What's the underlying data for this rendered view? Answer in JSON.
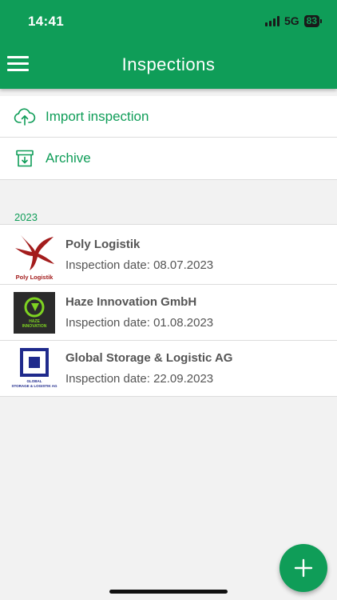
{
  "status_bar": {
    "time": "14:41",
    "network": "5G",
    "battery": "83"
  },
  "header": {
    "title": "Inspections"
  },
  "actions": [
    {
      "label": "Import inspection",
      "icon": "cloud-upload-icon"
    },
    {
      "label": "Archive",
      "icon": "archive-icon"
    }
  ],
  "section": {
    "year": "2023"
  },
  "inspections": [
    {
      "company": "Poly Logistik",
      "date": "Inspection date: 08.07.2023",
      "logo_text": "Poly Logistik",
      "logo_color": "#a31c1c"
    },
    {
      "company": "Haze Innovation GmbH",
      "date": "Inspection date: 01.08.2023",
      "logo_text_1": "HAZE",
      "logo_text_2": "INNOVATION",
      "logo_color": "#7ed321"
    },
    {
      "company": "Global Storage & Logistic AG",
      "date": "Inspection date: 22.09.2023",
      "logo_text_1": "GLOBAL",
      "logo_text_2": "STORAGE & LOGISTIK AG",
      "logo_color": "#1f2a8c"
    }
  ],
  "colors": {
    "primary": "#0f9d58",
    "background": "#f2f2f2"
  }
}
